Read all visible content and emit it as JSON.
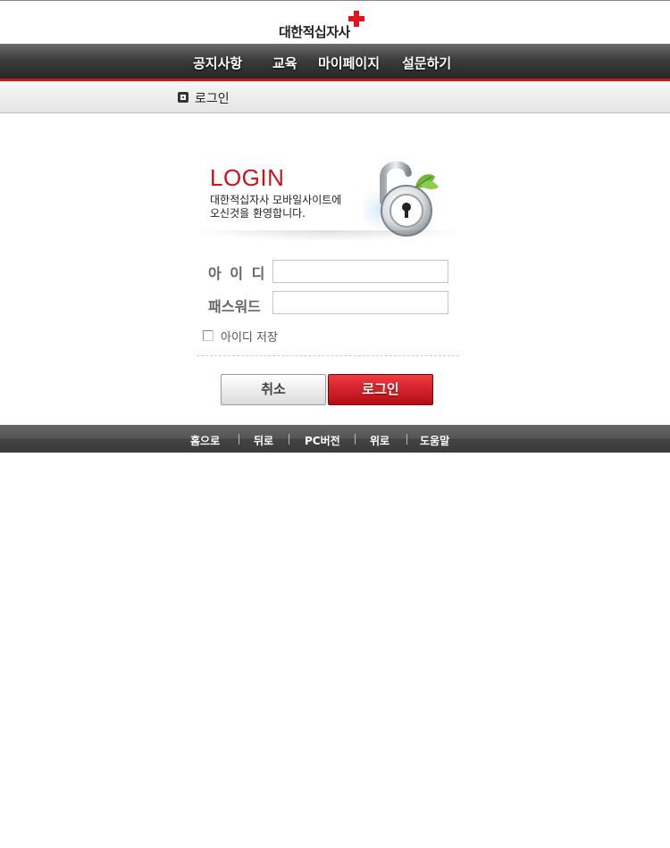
{
  "header": {
    "logo_text": "대한적십자사"
  },
  "nav": {
    "items": [
      "공지사항",
      "교육",
      "마이페이지",
      "설문하기"
    ]
  },
  "subbar": {
    "title": "로그인"
  },
  "login": {
    "title": "LOGIN",
    "message_line1": "대한적십자사 모바일사이트에",
    "message_line2": "오신것을 환영합니다.",
    "id_label": "아 이 디",
    "password_label": "패스워드",
    "id_value": "",
    "password_value": "",
    "remember_label": "아이디 저장",
    "cancel_label": "취소",
    "login_label": "로그인"
  },
  "footer": {
    "links": [
      "홈으로",
      "뒤로",
      "PC버전",
      "위로",
      "도움말"
    ]
  },
  "colors": {
    "accent": "#c8141c",
    "nav_dark": "#2f2f2f"
  }
}
